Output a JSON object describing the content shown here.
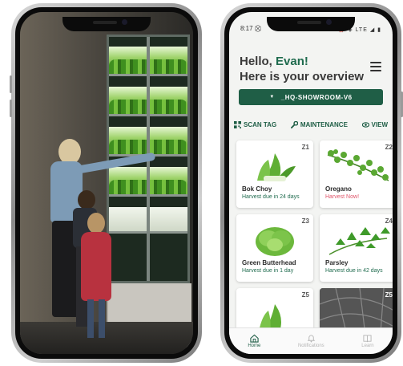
{
  "app": {
    "status_time": "8:17",
    "status_icons_left": "⛒",
    "status_icons_right": "⏰ ◈ LTE ◢ ▮",
    "greeting_prefix": "Hello, ",
    "user_name": "Evan!",
    "greeting_sub": "Here is your overview",
    "site_label": "_HQ-SHOWROOM-V6",
    "actions": [
      {
        "label": "SCAN TAG",
        "icon": "qr-icon"
      },
      {
        "label": "MAINTENANCE",
        "icon": "wrench-icon"
      },
      {
        "label": "VIEW",
        "icon": "eye-icon"
      }
    ],
    "zones": [
      {
        "zone": "Z1",
        "name": "Bok Choy",
        "due": "Harvest due in 24 days",
        "status": "normal"
      },
      {
        "zone": "Z2",
        "name": "Oregano",
        "due": "Harvest Now!",
        "status": "now"
      },
      {
        "zone": "Z3",
        "name": "Green Butterhead",
        "due": "Harvest due in 1 day",
        "status": "normal"
      },
      {
        "zone": "Z4",
        "name": "Parsley",
        "due": "Harvest due in 42 days",
        "status": "normal"
      },
      {
        "zone": "Z5",
        "name": "",
        "due": "",
        "status": "normal"
      },
      {
        "zone": "Z5",
        "name": "",
        "due": "",
        "status": "normal"
      }
    ],
    "nav": [
      {
        "label": "Home",
        "active": true
      },
      {
        "label": "Notifications",
        "active": false
      },
      {
        "label": "Learn",
        "active": false
      }
    ]
  },
  "colors": {
    "brand_green": "#1f5e46",
    "alert_pink": "#e0556a"
  }
}
